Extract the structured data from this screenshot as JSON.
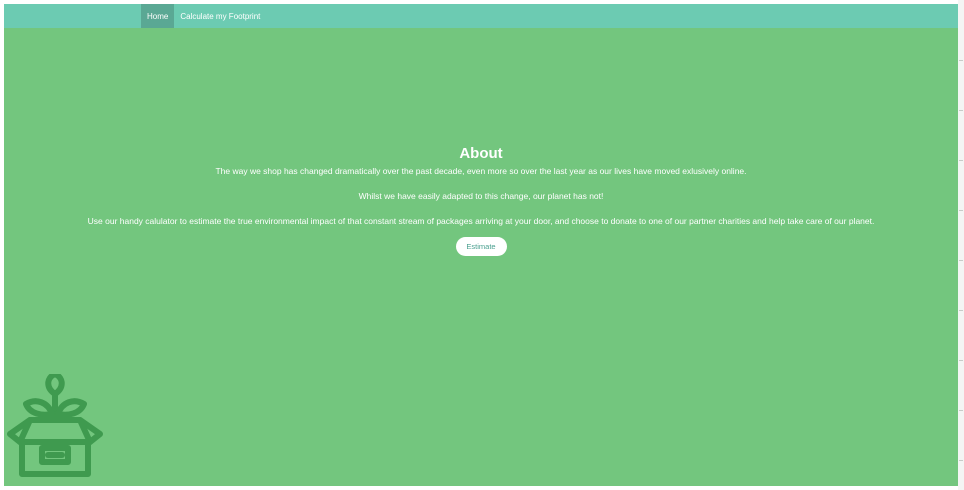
{
  "nav": {
    "items": [
      {
        "label": "Home",
        "active": true
      },
      {
        "label": "Calculate my Footprint",
        "active": false
      }
    ]
  },
  "about": {
    "title": "About",
    "paragraphs": [
      "The way we shop has changed dramatically over the past decade, even more so over the last year as our lives have moved exlusively online.",
      "Whilst we have easily adapted to this change, our planet has not!",
      "Use our handy calulator to estimate the true environmental impact of that constant stream of packages arriving at your door, and choose to donate to one of our partner charities and help take care of our planet."
    ],
    "button_label": "Estimate"
  },
  "colors": {
    "background": "#73c67e",
    "navbar": "#6ccbb2",
    "nav_active": "#5aa894",
    "button_text": "#4aa08f",
    "logo": "#3f9a4f"
  },
  "logo": {
    "icon": "plant-box-icon"
  }
}
